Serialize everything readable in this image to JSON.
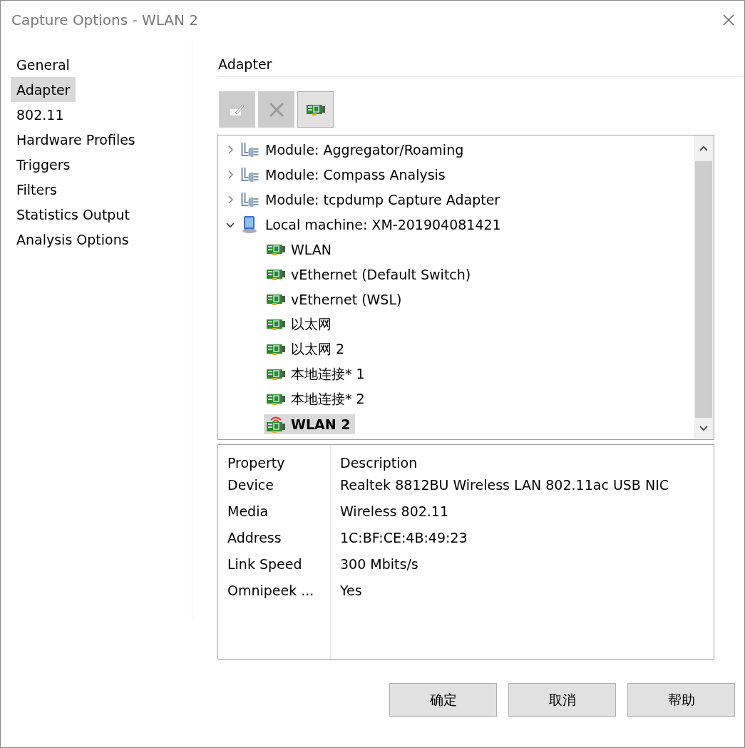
{
  "window": {
    "title": "Capture Options - WLAN 2"
  },
  "sidebar": {
    "items": [
      {
        "label": "General",
        "selected": false
      },
      {
        "label": "Adapter",
        "selected": true
      },
      {
        "label": "802.11",
        "selected": false
      },
      {
        "label": "Hardware Profiles",
        "selected": false
      },
      {
        "label": "Triggers",
        "selected": false
      },
      {
        "label": "Filters",
        "selected": false
      },
      {
        "label": "Statistics Output",
        "selected": false
      },
      {
        "label": "Analysis Options",
        "selected": false
      }
    ]
  },
  "section_title": "Adapter",
  "toolbar": [
    {
      "kind": "edit",
      "disabled": true
    },
    {
      "kind": "delete",
      "disabled": true
    },
    {
      "kind": "adapter",
      "disabled": false
    }
  ],
  "tree": [
    {
      "kind": "module",
      "label": "Module: Aggregator/Roaming",
      "expanded": false,
      "selected": false
    },
    {
      "kind": "module",
      "label": "Module: Compass Analysis",
      "expanded": false,
      "selected": false
    },
    {
      "kind": "module",
      "label": "Module: tcpdump Capture Adapter",
      "expanded": false,
      "selected": false
    },
    {
      "kind": "machine",
      "label": "Local machine: XM-201904081421",
      "expanded": true,
      "selected": false,
      "children": [
        {
          "kind": "adapter",
          "label": "WLAN",
          "selected": false
        },
        {
          "kind": "adapter",
          "label": "vEthernet (Default Switch)",
          "selected": false
        },
        {
          "kind": "adapter",
          "label": "vEthernet (WSL)",
          "selected": false
        },
        {
          "kind": "adapter",
          "label": "以太网",
          "selected": false
        },
        {
          "kind": "adapter",
          "label": "以太网 2",
          "selected": false
        },
        {
          "kind": "adapter",
          "label": "本地连接* 1",
          "selected": false
        },
        {
          "kind": "adapter",
          "label": "本地连接* 2",
          "selected": false
        },
        {
          "kind": "wireless",
          "label": "WLAN 2",
          "selected": true
        }
      ]
    }
  ],
  "properties": {
    "columns": [
      "Property",
      "Description"
    ],
    "rows": [
      [
        "Device",
        "Realtek 8812BU Wireless LAN 802.11ac USB NIC"
      ],
      [
        "Media",
        "Wireless 802.11"
      ],
      [
        "Address",
        "1C:BF:CE:4B:49:23"
      ],
      [
        "Link Speed",
        "300 Mbits/s"
      ],
      [
        "Omnipeek ...",
        "Yes"
      ]
    ]
  },
  "buttons": [
    "确定",
    "取消",
    "帮助"
  ]
}
